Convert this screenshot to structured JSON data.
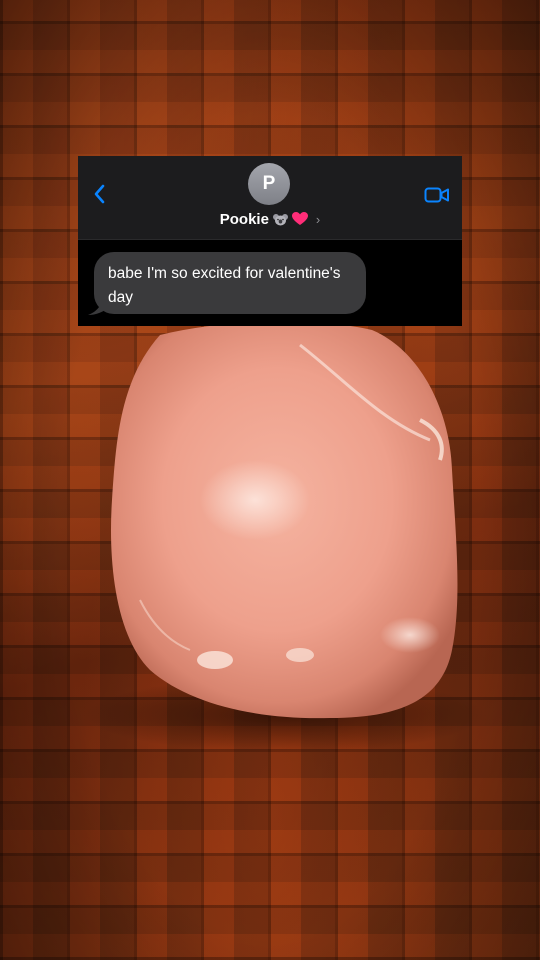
{
  "chat": {
    "avatar_initial": "P",
    "contact_name": "Pookie",
    "contact_emojis": [
      "koala-emoji",
      "pink-heart-emoji"
    ],
    "chevron": "›",
    "messages": [
      {
        "direction": "incoming",
        "text": "babe I'm so excited for valentine's day"
      }
    ]
  },
  "colors": {
    "accent_blue": "#0a84ff",
    "bubble_incoming": "#3a3a3c",
    "header_bg": "#1c1c1e",
    "avatar_gray": "#8e9097",
    "heart_pink": "#ff2d78"
  },
  "icons": {
    "back": "chevron-left-icon",
    "video": "video-camera-icon"
  }
}
